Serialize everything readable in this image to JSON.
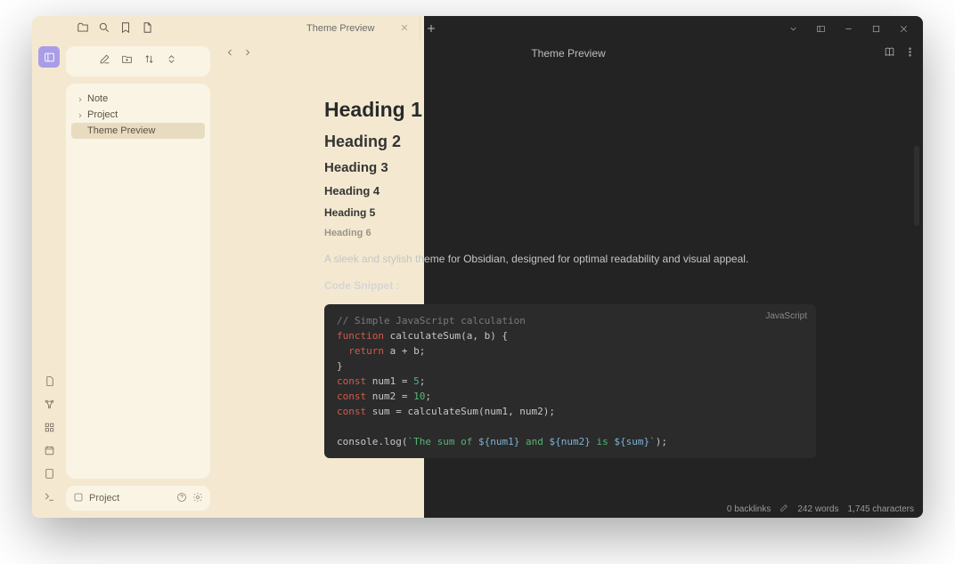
{
  "titlebar": {
    "tab_label": "Theme Preview"
  },
  "sidebar": {
    "items": [
      {
        "label": "Note",
        "expandable": true
      },
      {
        "label": "Project",
        "expandable": true
      },
      {
        "label": "Theme Preview",
        "expandable": false,
        "active": true
      }
    ],
    "footer_label": "Project"
  },
  "main": {
    "breadcrumb": "Theme Preview"
  },
  "note": {
    "h1": "Heading 1",
    "h2": "Heading 2",
    "h3": "Heading 3",
    "h4": "Heading 4",
    "h5": "Heading 5",
    "h6": "Heading 6",
    "paragraph": "A sleek and stylish theme for Obsidian, designed for optimal readability and visual appeal.",
    "code_label": "Code Snippet :",
    "code_lang": "JavaScript",
    "code": {
      "l1_comment": "// Simple JavaScript calculation",
      "l2_kw": "function",
      "l2_name": " calculateSum(a, b) {",
      "l3_kw": "return",
      "l3_rest": " a + b;",
      "l4": "}",
      "l5_kw": "const",
      "l5_rest_a": " num1 ",
      "l5_eq": "=",
      "l5_num": " 5",
      "l5_semi": ";",
      "l6_kw": "const",
      "l6_rest_a": " num2 ",
      "l6_eq": "=",
      "l6_num": " 10",
      "l6_semi": ";",
      "l7_kw": "const",
      "l7_rest": " sum = calculateSum(num1, num2);",
      "l8_a": "console.log(",
      "l8_tick": "`",
      "l8_s1": "The sum of ",
      "l8_i1": "${",
      "l8_v1": "num1",
      "l8_i1c": "}",
      "l8_s2": " and ",
      "l8_i2": "${",
      "l8_v2": "num2",
      "l8_i2c": "}",
      "l8_s3": " is ",
      "l8_i3": "${",
      "l8_v3": "sum",
      "l8_i3c": "}",
      "l8_tick2": "`",
      "l8_b": ");"
    }
  },
  "status": {
    "backlinks": "0 backlinks",
    "words": "242 words",
    "chars": "1,745 characters"
  }
}
